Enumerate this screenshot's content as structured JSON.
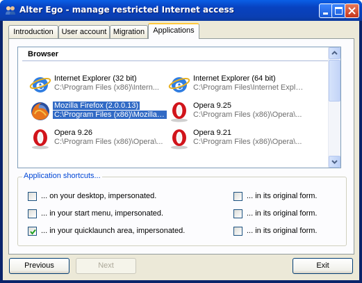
{
  "window": {
    "title": "Alter Ego - manage restricted Internet access"
  },
  "tabs": [
    {
      "label": "Introduction",
      "active": false
    },
    {
      "label": "User account",
      "active": false
    },
    {
      "label": "Migration",
      "active": false
    },
    {
      "label": "Applications",
      "active": true
    }
  ],
  "applications": {
    "group_label": "Browser",
    "items": [
      {
        "name": "Internet Explorer (32 bit)",
        "path": "C:\\Program Files (x86)\\Intern...",
        "icon": "internet-explorer-icon",
        "selected": false
      },
      {
        "name": "Internet Explorer (64 bit)",
        "path": "C:\\Program Files\\Internet Explor...",
        "icon": "internet-explorer-icon",
        "selected": false
      },
      {
        "name": "Mozilla Firefox (2.0.0.13)",
        "path": "C:\\Program Files (x86)\\Mozilla ...",
        "icon": "firefox-icon",
        "selected": true
      },
      {
        "name": "Opera 9.25",
        "path": "C:\\Program Files (x86)\\Opera\\...",
        "icon": "opera-icon",
        "selected": false
      },
      {
        "name": "Opera 9.26",
        "path": "C:\\Program Files (x86)\\Opera\\...",
        "icon": "opera-icon",
        "selected": false
      },
      {
        "name": "Opera 9.21",
        "path": "C:\\Program Files (x86)\\Opera\\...",
        "icon": "opera-icon",
        "selected": false
      }
    ]
  },
  "shortcuts": {
    "title": "Application shortcuts...",
    "impersonated": [
      {
        "label": "... on your desktop, impersonated.",
        "checked": false
      },
      {
        "label": "... in your start menu, impersonated.",
        "checked": false
      },
      {
        "label": "... in your quicklaunch area, impersonated.",
        "checked": true
      }
    ],
    "original": [
      {
        "label": "... in its original form.",
        "checked": false
      },
      {
        "label": "... in its original form.",
        "checked": false
      },
      {
        "label": "... in its original form.",
        "checked": false
      }
    ]
  },
  "buttons": {
    "previous": "Previous",
    "next": "Next",
    "exit": "Exit"
  },
  "colors": {
    "accent": "#316ac5",
    "groupbox_title": "#0046d5"
  }
}
